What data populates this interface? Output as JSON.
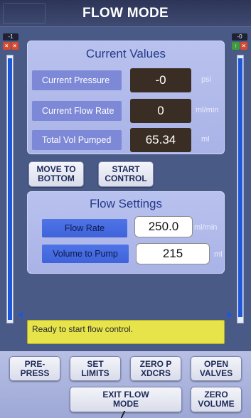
{
  "header": {
    "title": "FLOW MODE"
  },
  "left_scroll": {
    "label": "-1",
    "close_icon": "×",
    "close2_icon": "×"
  },
  "right_scroll": {
    "label": "-0",
    "up_icon": "↑",
    "close_icon": "×"
  },
  "current_values": {
    "title": "Current Values",
    "rows": [
      {
        "label": "Current Pressure",
        "value": "-0",
        "unit": "psi"
      },
      {
        "label": "Current Flow Rate",
        "value": "0",
        "unit": "ml/min"
      },
      {
        "label": "Total Vol Pumped",
        "value": "65.34",
        "unit": "ml"
      }
    ]
  },
  "mid_buttons": {
    "move_to_bottom": "MOVE TO\nBOTTOM",
    "start_control": "START\nCONTROL"
  },
  "flow_settings": {
    "title": "Flow Settings",
    "rows": [
      {
        "label": "Flow Rate",
        "value": "250.0",
        "unit": "ml/min"
      },
      {
        "label": "Volume to Pump",
        "value": "215",
        "unit": "ml"
      }
    ]
  },
  "status": {
    "message": "Ready to start flow control."
  },
  "bottom_buttons": {
    "pre_press": "PRE-\nPRESS",
    "set_limits": "SET\nLIMITS",
    "zero_p_xdcrs": "ZERO P\nXDCRS",
    "open_valves": "OPEN\nVALVES",
    "exit_flow_mode": "EXIT FLOW\nMODE",
    "zero_volume": "ZERO\nVOLUME"
  },
  "colors": {
    "panel": "#b9c2ee",
    "value_dark": "#3a2e24",
    "status_bg": "#e6e44a",
    "scroll_fill": "#1f58d6"
  },
  "icons": [
    "close-icon",
    "arrow-up-icon",
    "scroll-marker-icon"
  ]
}
